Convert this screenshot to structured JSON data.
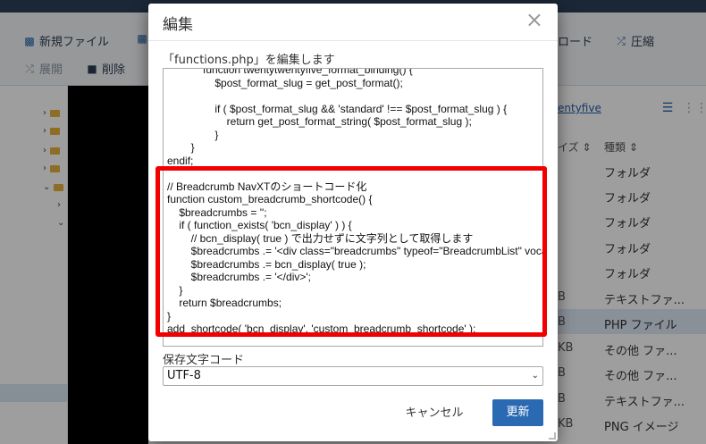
{
  "background": {
    "toolbar": {
      "new_file": "新規ファイル",
      "download_partial": "ロード",
      "compress": "圧縮",
      "expand": "展開",
      "delete": "削除"
    },
    "breadcrumb_partial": "entyfive",
    "columns": {
      "size": "イズ",
      "type": "種類"
    },
    "files": [
      {
        "size": "",
        "type": "フォルダ"
      },
      {
        "size": "",
        "type": "フォルダ"
      },
      {
        "size": "",
        "type": "フォルダ"
      },
      {
        "size": "",
        "type": "フォルダ"
      },
      {
        "size": "",
        "type": "フォルダ"
      },
      {
        "size": "B",
        "type": "テキストファ..."
      },
      {
        "size": "B",
        "type": "PHP ファイル"
      },
      {
        "size": "KB",
        "type": "その他 ファ..."
      },
      {
        "size": "B",
        "type": "その他 ファ..."
      },
      {
        "size": "B",
        "type": "テキストファ..."
      },
      {
        "size": "KB",
        "type": "PNG イメージ"
      }
    ]
  },
  "modal": {
    "title": "編集",
    "close_icon": "×",
    "edit_label": "「functions.php」を編集します",
    "code": "            function twentytwentyfive_format_binding() {\n                $post_format_slug = get_post_format();\n\n                if ( $post_format_slug && 'standard' !== $post_format_slug ) {\n                    return get_post_format_string( $post_format_slug );\n                }\n        }\nendif;\n\n// Breadcrumb NavXTのショートコード化\nfunction custom_breadcrumb_shortcode() {\n    $breadcrumbs = '';\n    if ( function_exists( 'bcn_display' ) ) {\n        // bcn_display( true ) で出力せずに文字列として取得します\n        $breadcrumbs .= '<div class=\"breadcrumbs\" typeof=\"BreadcrumbList\" vocab=\"https://schema.org/\">';\n        $breadcrumbs .= bcn_display( true );\n        $breadcrumbs .= '</div>';\n    }\n    return $breadcrumbs;\n}\nadd_shortcode( 'bcn_display', 'custom_breadcrumb_shortcode' );",
    "encoding_label": "保存文字コード",
    "encoding_value": "UTF-8",
    "cancel_label": "キャンセル",
    "update_label": "更新"
  },
  "colors": {
    "primary": "#2a6ab3",
    "highlight": "#f20000",
    "folder": "#e6b13a"
  }
}
